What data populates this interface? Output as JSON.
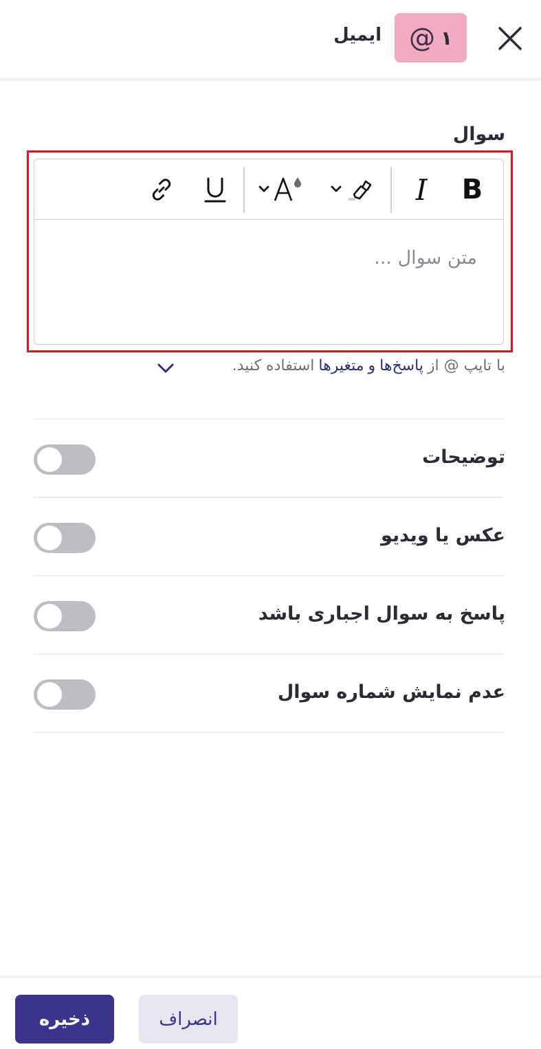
{
  "header": {
    "title": "ایمیل",
    "badge_number": "۱",
    "badge_symbol": "@",
    "badge_icon": "at-icon",
    "close_icon": "close-icon",
    "badge_color": "#f2aac0"
  },
  "question": {
    "label": "سوال",
    "placeholder": "متن سوال ...",
    "toolbar": {
      "bold": "B",
      "italic": "I",
      "underline": "U",
      "highlight_icon": "highlighter-icon",
      "color_icon": "text-color-icon",
      "link_icon": "link-icon"
    },
    "helper": {
      "prefix": "با تایپ @ از",
      "link_answers": "پاسخ‌ها",
      "conjunction": "و",
      "link_variables": "متغیرها",
      "suffix": "استفاده کنید."
    }
  },
  "settings": [
    {
      "label": "توضیحات",
      "enabled": false
    },
    {
      "label": "عکس یا ویدیو",
      "enabled": false
    },
    {
      "label": "پاسخ به سوال اجباری باشد",
      "enabled": false
    },
    {
      "label": "عدم نمایش شماره سوال",
      "enabled": false
    }
  ],
  "footer": {
    "save_label": "ذخیره",
    "cancel_label": "انصراف",
    "primary_color": "#3b348c"
  }
}
